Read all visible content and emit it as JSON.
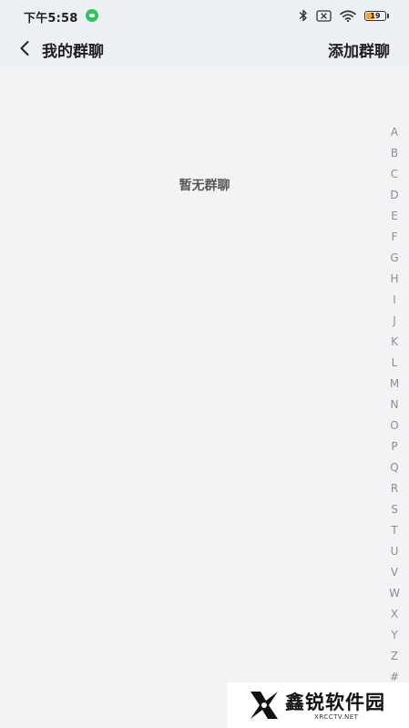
{
  "status_bar": {
    "time": "下午5:58",
    "battery": "19",
    "icons": [
      "bluetooth-icon",
      "sim-off-icon",
      "wifi-icon",
      "battery-icon"
    ],
    "colors": {
      "chat_dot": "#2fc45a",
      "battery_fill": "#f2a43a"
    }
  },
  "nav": {
    "back_icon": "chevron-left-icon",
    "title": "我的群聊",
    "action_label": "添加群聊"
  },
  "content": {
    "empty_text": "暂无群聊"
  },
  "index_bar": {
    "letters": [
      "A",
      "B",
      "C",
      "D",
      "E",
      "F",
      "G",
      "H",
      "I",
      "J",
      "K",
      "L",
      "M",
      "N",
      "O",
      "P",
      "Q",
      "R",
      "S",
      "T",
      "U",
      "V",
      "W",
      "X",
      "Y",
      "Z",
      "#"
    ]
  },
  "watermark": {
    "logo": "x-logo",
    "title": "鑫锐软件园",
    "subtitle": "XRCCTV.NET"
  }
}
